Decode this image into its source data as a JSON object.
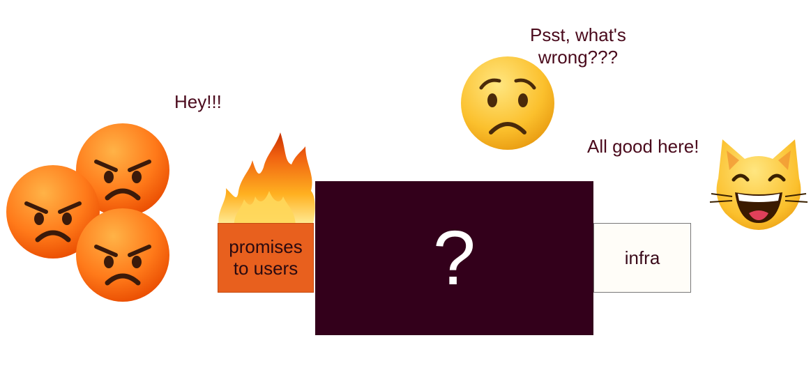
{
  "speech": {
    "angry_users": "Hey!!!",
    "worried_face": [
      "Psst, what's",
      "wrong???"
    ],
    "happy_cat": "All good here!"
  },
  "boxes": {
    "promises": [
      "promises",
      "to users"
    ],
    "mystery": "?",
    "infra": "infra"
  },
  "icons": [
    "angry-face-icon",
    "fire-icon",
    "worried-face-icon",
    "grinning-cat-icon"
  ],
  "colors": {
    "promises_fill": "#e8601e",
    "mystery_fill": "#33001b",
    "text": "#4a0a1c"
  }
}
